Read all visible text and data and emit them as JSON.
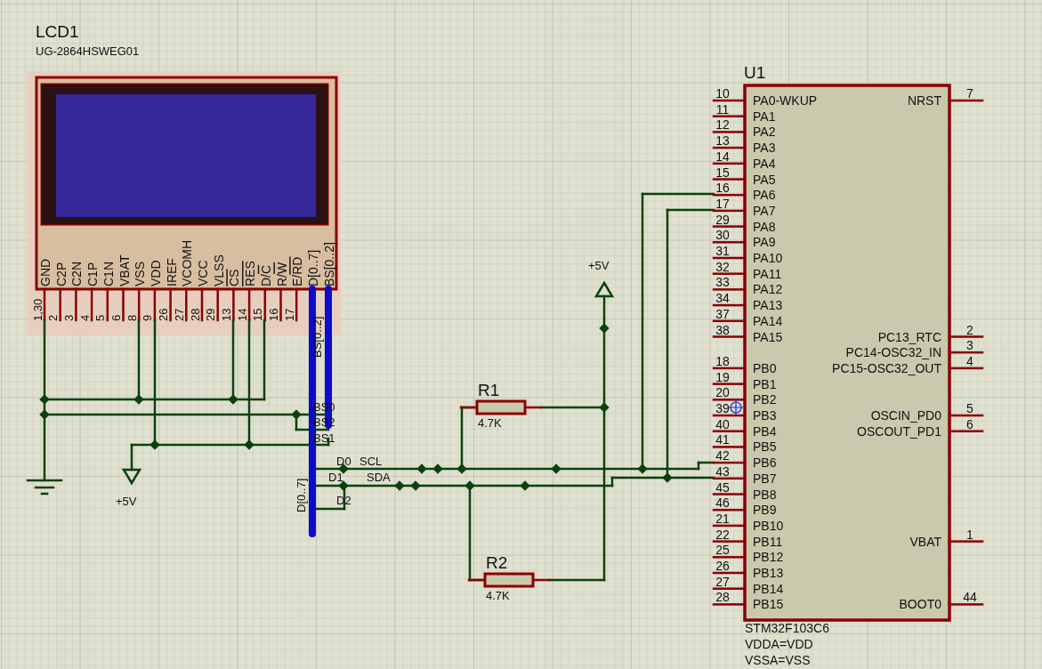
{
  "lcd": {
    "ref": "LCD1",
    "part": "UG-2864HSWEG01",
    "pins": [
      {
        "label": "GND",
        "number": "1,30"
      },
      {
        "label": "C2P",
        "number": "2"
      },
      {
        "label": "C2N",
        "number": "3"
      },
      {
        "label": "C1P",
        "number": "4"
      },
      {
        "label": "C1N",
        "number": "5"
      },
      {
        "label": "VBAT",
        "number": "6"
      },
      {
        "label": "VSS",
        "number": "8"
      },
      {
        "label": "VDD",
        "number": "9"
      },
      {
        "label": "IREF",
        "number": "26"
      },
      {
        "label": "VCOMH",
        "number": "27"
      },
      {
        "label": "VCC",
        "number": "28"
      },
      {
        "label": "VLSS",
        "number": "29"
      },
      {
        "barred": "CS",
        "number": "13"
      },
      {
        "barred": "RES",
        "number": "14"
      },
      {
        "label": "D/",
        "barred": "C",
        "number": "15"
      },
      {
        "label": "R/",
        "barred": "W",
        "number": "16"
      },
      {
        "label": "E/",
        "barred": "RD",
        "number": "17"
      },
      {
        "label": "D[0..7]"
      },
      {
        "label": "BS[0..2]"
      }
    ]
  },
  "bus_labels": [
    "BS[0..2]",
    "D[0..7]"
  ],
  "net_labels": [
    "BS0",
    "BS2",
    "BS1",
    "D0",
    "D1",
    "D2",
    "SCL",
    "SDA"
  ],
  "resistors": [
    {
      "ref": "R1",
      "value": "4.7K"
    },
    {
      "ref": "R2",
      "value": "4.7K"
    }
  ],
  "power": [
    {
      "label": "+5V"
    },
    {
      "label": "+5V"
    }
  ],
  "mcu": {
    "ref": "U1",
    "left_pins": [
      {
        "label": "PA0-WKUP",
        "number": "10"
      },
      {
        "label": "PA1",
        "number": "11"
      },
      {
        "label": "PA2",
        "number": "12"
      },
      {
        "label": "PA3",
        "number": "13"
      },
      {
        "label": "PA4",
        "number": "14"
      },
      {
        "label": "PA5",
        "number": "15"
      },
      {
        "label": "PA6",
        "number": "16"
      },
      {
        "label": "PA7",
        "number": "17"
      },
      {
        "label": "PA8",
        "number": "29"
      },
      {
        "label": "PA9",
        "number": "30"
      },
      {
        "label": "PA10",
        "number": "31"
      },
      {
        "label": "PA11",
        "number": "32"
      },
      {
        "label": "PA12",
        "number": "33"
      },
      {
        "label": "PA13",
        "number": "34"
      },
      {
        "label": "PA14",
        "number": "37"
      },
      {
        "label": "PA15",
        "number": "38"
      },
      {
        "label": "PB0",
        "number": "18"
      },
      {
        "label": "PB1",
        "number": "19"
      },
      {
        "label": "PB2",
        "number": "20"
      },
      {
        "label": "PB3",
        "number": "39"
      },
      {
        "label": "PB4",
        "number": "40"
      },
      {
        "label": "PB5",
        "number": "41"
      },
      {
        "label": "PB6",
        "number": "42"
      },
      {
        "label": "PB7",
        "number": "43"
      },
      {
        "label": "PB8",
        "number": "45"
      },
      {
        "label": "PB9",
        "number": "46"
      },
      {
        "label": "PB10",
        "number": "21"
      },
      {
        "label": "PB11",
        "number": "22"
      },
      {
        "label": "PB12",
        "number": "25"
      },
      {
        "label": "PB13",
        "number": "26"
      },
      {
        "label": "PB14",
        "number": "27"
      },
      {
        "label": "PB15",
        "number": "28"
      }
    ],
    "right_pins": [
      {
        "label": "NRST",
        "number": "7"
      },
      {
        "label": "PC13_RTC",
        "number": "2"
      },
      {
        "label": "PC14-OSC32_IN",
        "number": "3"
      },
      {
        "label": "PC15-OSC32_OUT",
        "number": "4"
      },
      {
        "label": "OSCIN_PD0",
        "number": "5"
      },
      {
        "label": "OSCOUT_PD1",
        "number": "6"
      },
      {
        "label": "VBAT",
        "number": "1"
      },
      {
        "label": "BOOT0",
        "number": "44"
      }
    ],
    "notes": [
      "STM32F103C6",
      "VDDA=VDD",
      "VSSA=VSS"
    ]
  }
}
